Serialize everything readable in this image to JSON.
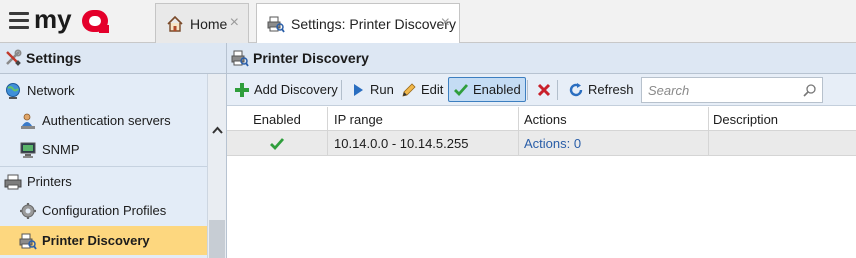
{
  "app": {
    "brand": "myQ",
    "brand_color": "#e4002b"
  },
  "tabs": [
    {
      "label": "Home",
      "icon": "home-icon",
      "close": "×"
    },
    {
      "label": "Settings: Printer Discovery",
      "icon": "printer-search-icon",
      "close": "×",
      "active": true
    }
  ],
  "sidebar": {
    "title": "Settings",
    "title_icon": "wrench-screwdriver-icon",
    "items": [
      {
        "label": "Network",
        "icon": "globe-icon",
        "level": 0
      },
      {
        "label": "Authentication servers",
        "icon": "user-server-icon",
        "level": 1
      },
      {
        "label": "SNMP",
        "icon": "monitor-icon",
        "level": 1
      },
      {
        "label": "Printers",
        "icon": "printer-icon",
        "level": 0
      },
      {
        "label": "Configuration Profiles",
        "icon": "gear-icon",
        "level": 1
      },
      {
        "label": "Printer Discovery",
        "icon": "printer-search-icon",
        "level": 1,
        "selected": true
      }
    ],
    "selected_color": "#fdd77f"
  },
  "main": {
    "title": "Printer Discovery",
    "title_icon": "printer-search-icon",
    "toolbar": {
      "add_label": "Add Discovery",
      "run_label": "Run",
      "edit_label": "Edit",
      "enabled_label": "Enabled",
      "enabled_pressed": true,
      "refresh_label": "Refresh",
      "delete_icon": "delete-x-icon"
    },
    "search": {
      "placeholder": "Search",
      "value": ""
    },
    "grid": {
      "columns": [
        "Enabled",
        "IP range",
        "Actions",
        "Description"
      ],
      "rows": [
        {
          "enabled": true,
          "ip_range": "10.14.0.0 - 10.14.5.255",
          "actions": "Actions: 0",
          "description": ""
        }
      ]
    }
  }
}
